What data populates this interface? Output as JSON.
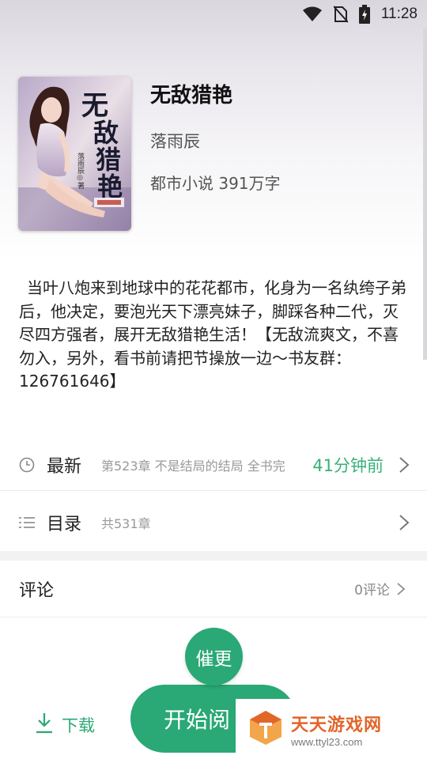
{
  "status_bar": {
    "time": "11:28",
    "icons": [
      "wifi-icon",
      "no-sim-icon",
      "battery-charging-icon"
    ]
  },
  "book": {
    "title": "无敌猎艳",
    "author": "落雨辰",
    "meta": "都市小说 391万字",
    "cover": {
      "title_art": [
        "无",
        "敌",
        "猎",
        "艳"
      ],
      "author_art": "落雨辰◎著",
      "colors": {
        "title": "#1a1a2e",
        "accent": "#c0392b",
        "skin": "#f3d6c9",
        "hair": "#3a1e1a"
      }
    }
  },
  "synopsis": "当叶八炮来到地球中的花花都市，化身为一名纨绔子弟后，他决定，要泡光天下漂亮妹子，脚踩各种二代，灭尽四方强者，展开无敌猎艳生活！【无敌流爽文，不喜勿入，另外，看书前请把节操放一边～书友群：126761646】",
  "latest": {
    "label": "最新",
    "chapter": "第523章 不是结局的结局 全书完",
    "time": "41分钟前",
    "icon": "clock-icon"
  },
  "toc": {
    "label": "目录",
    "count": "共531章",
    "icon": "list-icon"
  },
  "comments": {
    "label": "评论",
    "count": "0评论"
  },
  "actions": {
    "urge": "催更",
    "download": "下载",
    "read": "开始阅"
  },
  "watermark": {
    "title": "天天游戏网",
    "url": "www.ttyl23.com"
  },
  "colors": {
    "accent_green": "#2aa875",
    "time_green": "#3ab07a",
    "watermark_orange": "#e2652a"
  }
}
